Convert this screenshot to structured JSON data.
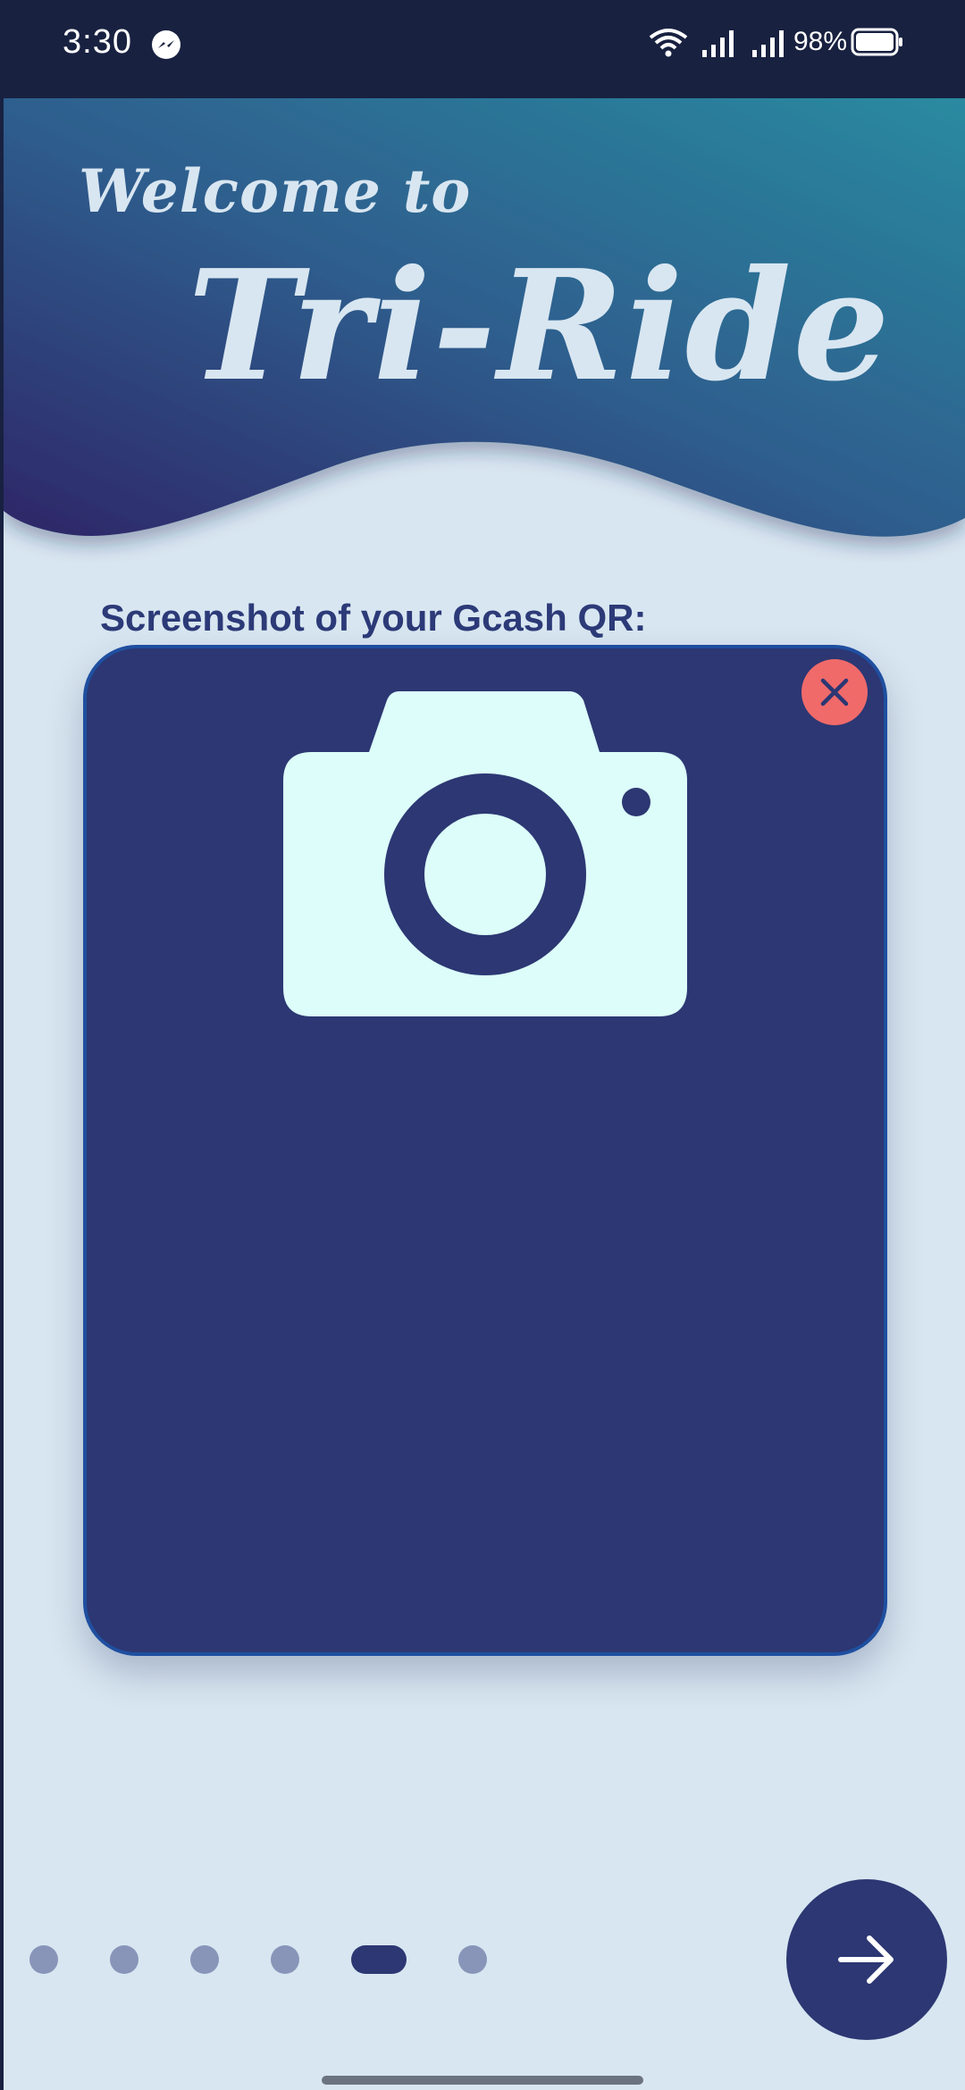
{
  "status_bar": {
    "time": "3:30",
    "battery_percent": "98%",
    "icons": [
      "messenger-icon",
      "wifi-icon",
      "signal-icon",
      "signal-icon",
      "battery-icon"
    ]
  },
  "header": {
    "welcome": "Welcome to",
    "app_name": "Tri-Ride"
  },
  "main": {
    "section_label": "Screenshot of your Gcash QR:",
    "upload_icon": "camera-icon",
    "close_icon": "close-icon"
  },
  "pagination": {
    "total_pages": 6,
    "current_page": 5
  },
  "navigation": {
    "next_icon": "arrow-right-icon"
  },
  "colors": {
    "primary": "#2c3773",
    "background": "#d8e6f1",
    "status_bar": "#182140",
    "close_accent": "#f06a6a",
    "camera_fill": "#dcfdf9",
    "hero_gradient_start": "#2e2668",
    "hero_gradient_end": "#2a8aa0"
  }
}
